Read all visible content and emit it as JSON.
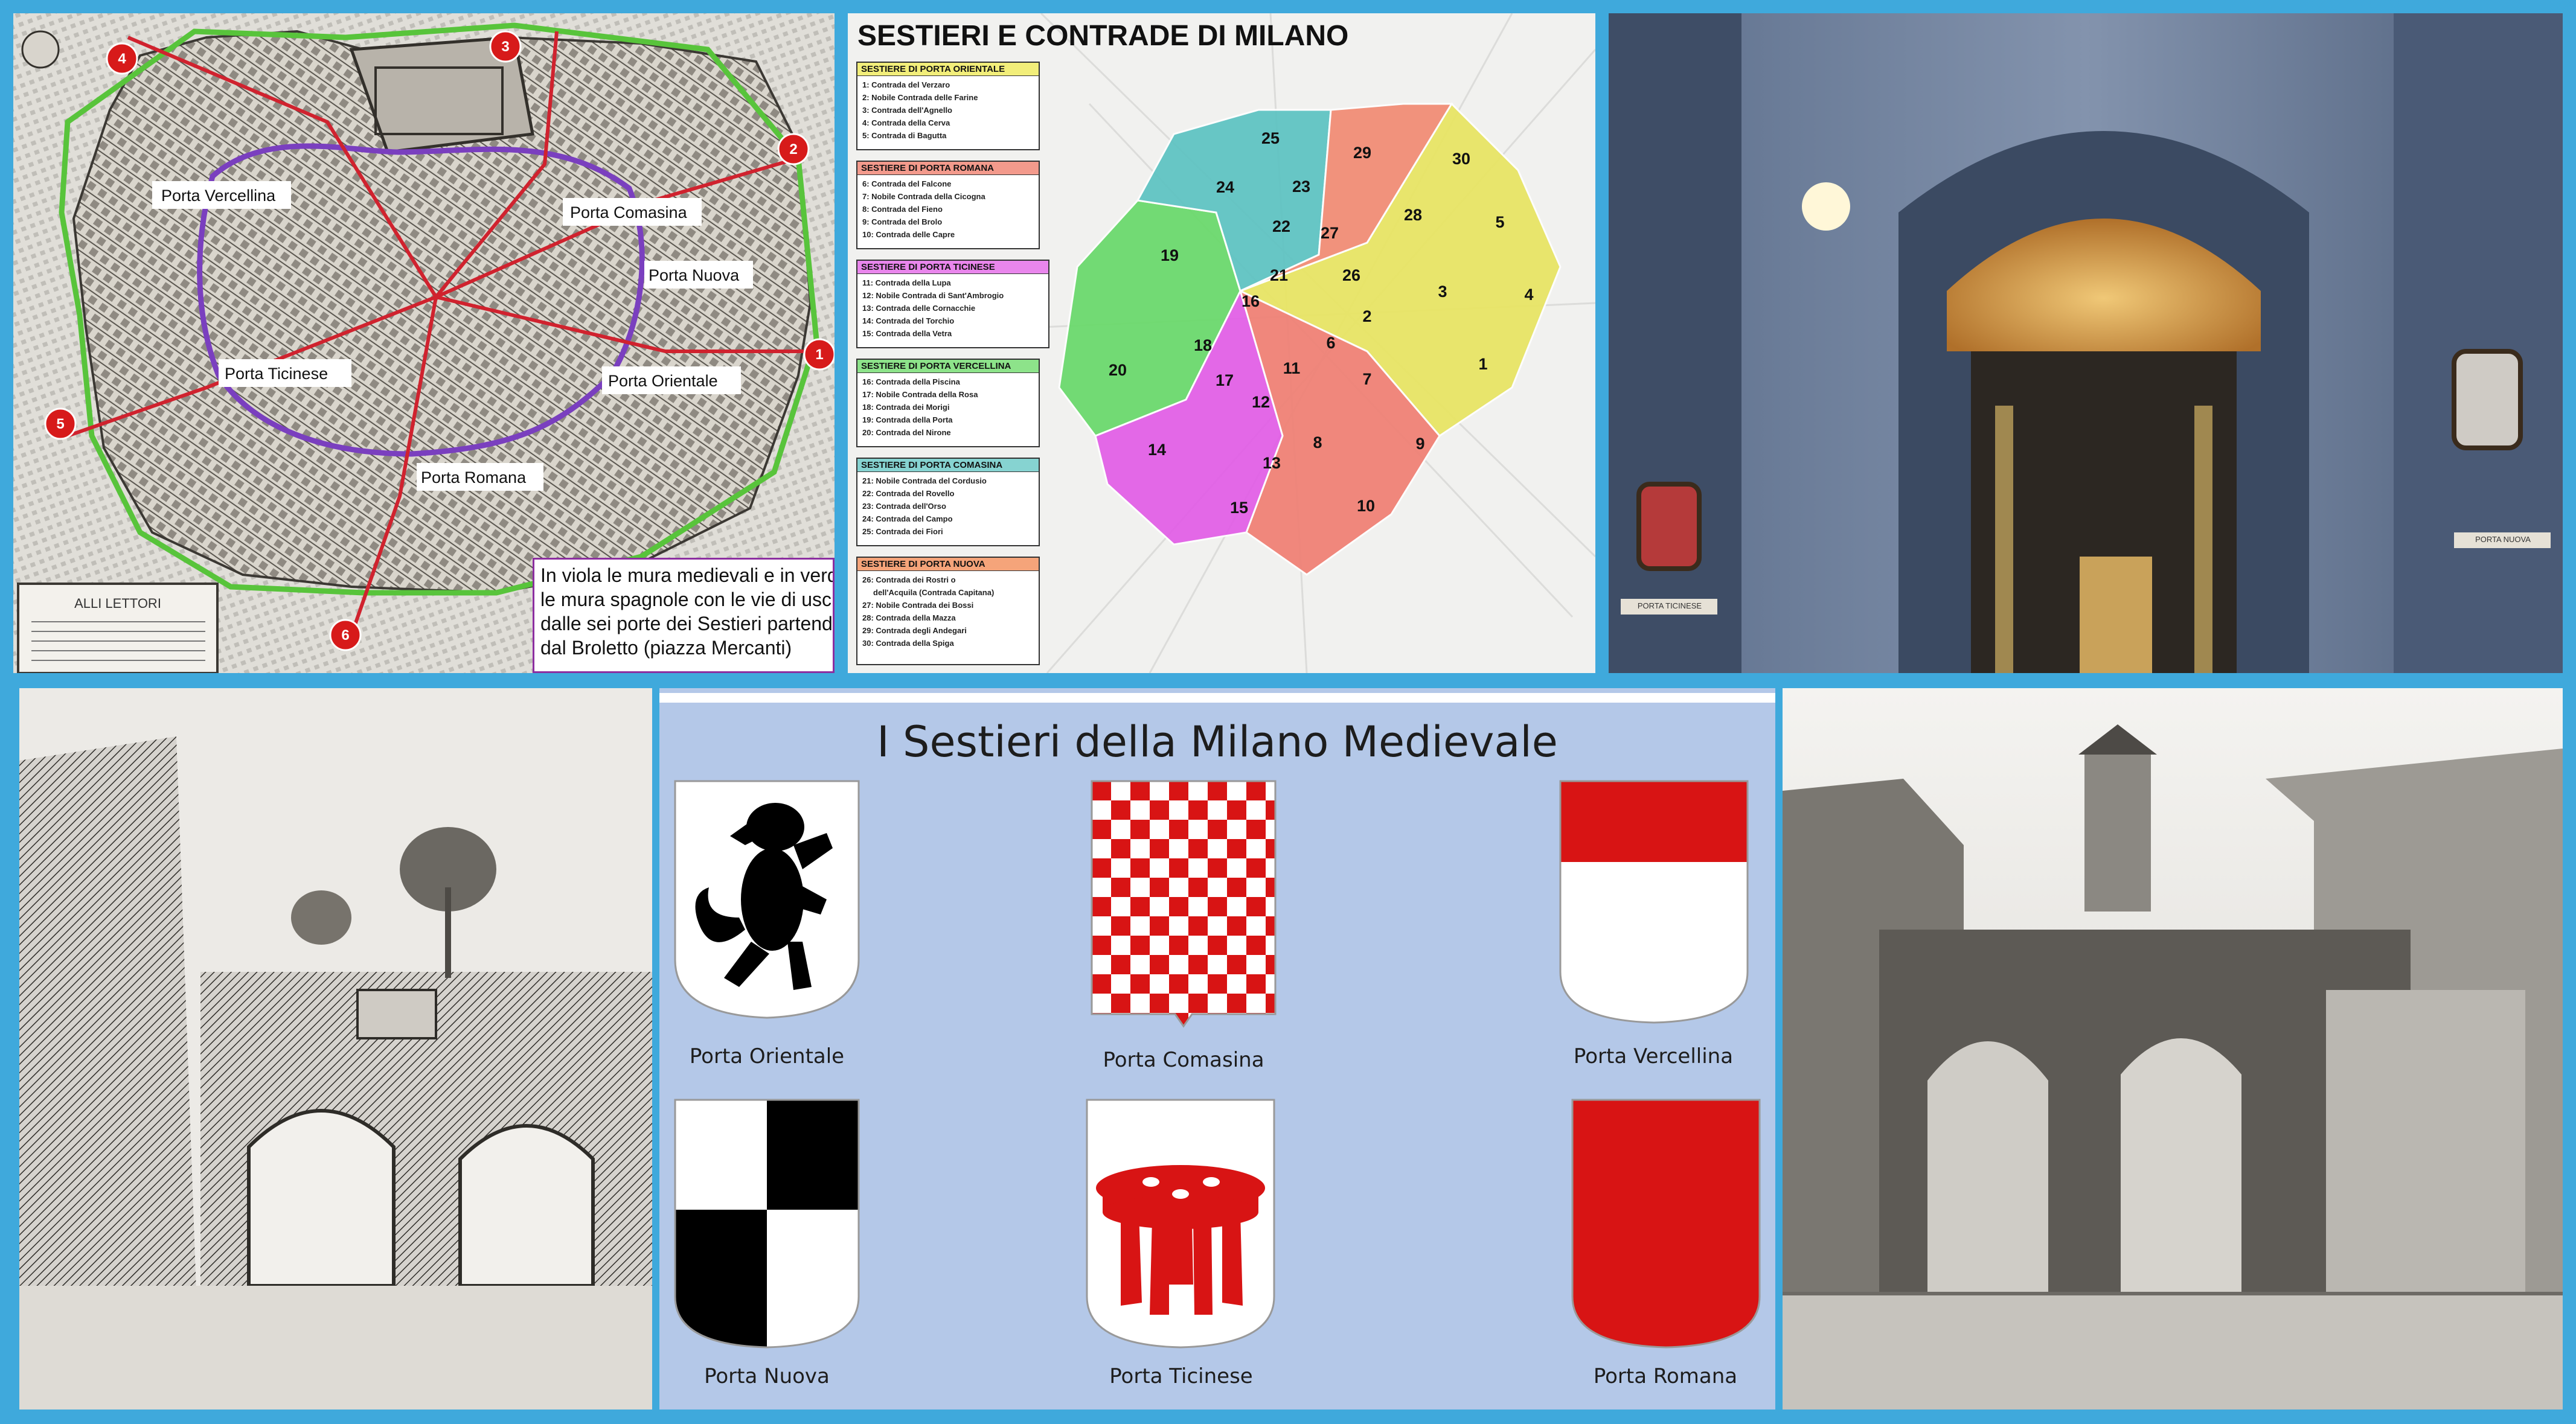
{
  "map_panel": {
    "labels": {
      "vercellina": "Porta Vercellina",
      "comasina": "Porta Comasina",
      "nuova": "Porta Nuova",
      "orientale": "Porta Orientale",
      "ticinese": "Porta Ticinese",
      "romana": "Porta Romana"
    },
    "markers": [
      "1",
      "2",
      "3",
      "4",
      "5",
      "6"
    ],
    "cartouche": "ALLI LETTORI",
    "note_lines": [
      "In viola le mura medievali e in verde",
      "le mura spagnole con le vie di uscita",
      "dalle sei porte dei Sestieri partendo",
      "dal Broletto (piazza Mercanti)"
    ]
  },
  "contrade_panel": {
    "title": "SESTIERI E CONTRADE DI MILANO",
    "sections": [
      {
        "header": "SESTIERE DI PORTA ORIENTALE",
        "color": "#f2ee7a",
        "items": [
          "1: Contrada del Verzaro",
          "2: Nobile Contrada delle Farine",
          "3: Contrada dell'Agnello",
          "4: Contrada della Cerva",
          "5: Contrada di Bagutta"
        ]
      },
      {
        "header": "SESTIERE DI PORTA ROMANA",
        "color": "#f39a8c",
        "items": [
          "6: Contrada del Falcone",
          "7: Nobile Contrada della Cicogna",
          "8: Contrada del Fieno",
          "9: Contrada del Brolo",
          "10: Contrada delle Capre"
        ]
      },
      {
        "header": "SESTIERE DI PORTA TICINESE",
        "color": "#e986ec",
        "items": [
          "11: Contrada della Lupa",
          "12: Nobile Contrada di Sant'Ambrogio",
          "13: Contrada delle Cornacchie",
          "14: Contrada del Torchio",
          "15: Contrada della Vetra"
        ]
      },
      {
        "header": "SESTIERE DI PORTA VERCELLINA",
        "color": "#8de38a",
        "items": [
          "16: Contrada della Piscina",
          "17: Nobile Contrada della Rosa",
          "18: Contrada dei Morigi",
          "19: Contrada della Porta",
          "20: Contrada del Nirone"
        ]
      },
      {
        "header": "SESTIERE DI PORTA COMASINA",
        "color": "#86d3d1",
        "items": [
          "21: Nobile Contrada del Cordusio",
          "22: Contrada del Rovello",
          "23: Contrada dell'Orso",
          "24: Contrada del Campo",
          "25: Contrada dei Fiori"
        ]
      },
      {
        "header": "SESTIERE DI PORTA NUOVA",
        "color": "#f5a47a",
        "items": [
          "26: Contrada dei Rostri o",
          "dell'Acquila (Contrada Capitana)",
          "27: Nobile Contrada dei Bossi",
          "28: Contrada della Mazza",
          "29: Contrada degli Andegari",
          "30: Contrada della Spiga"
        ]
      }
    ],
    "district_numbers": [
      "1",
      "2",
      "3",
      "4",
      "5",
      "6",
      "7",
      "8",
      "9",
      "10",
      "11",
      "12",
      "13",
      "14",
      "15",
      "16",
      "17",
      "18",
      "19",
      "20",
      "21",
      "22",
      "23",
      "24",
      "25",
      "26",
      "27",
      "28",
      "29",
      "30"
    ],
    "region_colors": {
      "orientale": "#e8e561",
      "romana": "#f07f73",
      "ticinese": "#e25de7",
      "vercellina": "#68d96a",
      "comasina": "#5cc3c2",
      "nuova": "#f28a73"
    }
  },
  "church_panel": {
    "plaques": [
      "PORTA TICINESE",
      "PORTA NUOVA"
    ]
  },
  "shields_panel": {
    "title": "I Sestieri della Milano Medievale",
    "captions": {
      "orientale": "Porta Orientale",
      "comasina": "Porta Comasina",
      "vercellina": "Porta Vercellina",
      "nuova": "Porta Nuova",
      "ticinese": "Porta Ticinese",
      "romana": "Porta Romana"
    },
    "colors": {
      "red": "#d81414",
      "black": "#000000",
      "white": "#ffffff",
      "background": "#b4c8e8"
    }
  }
}
